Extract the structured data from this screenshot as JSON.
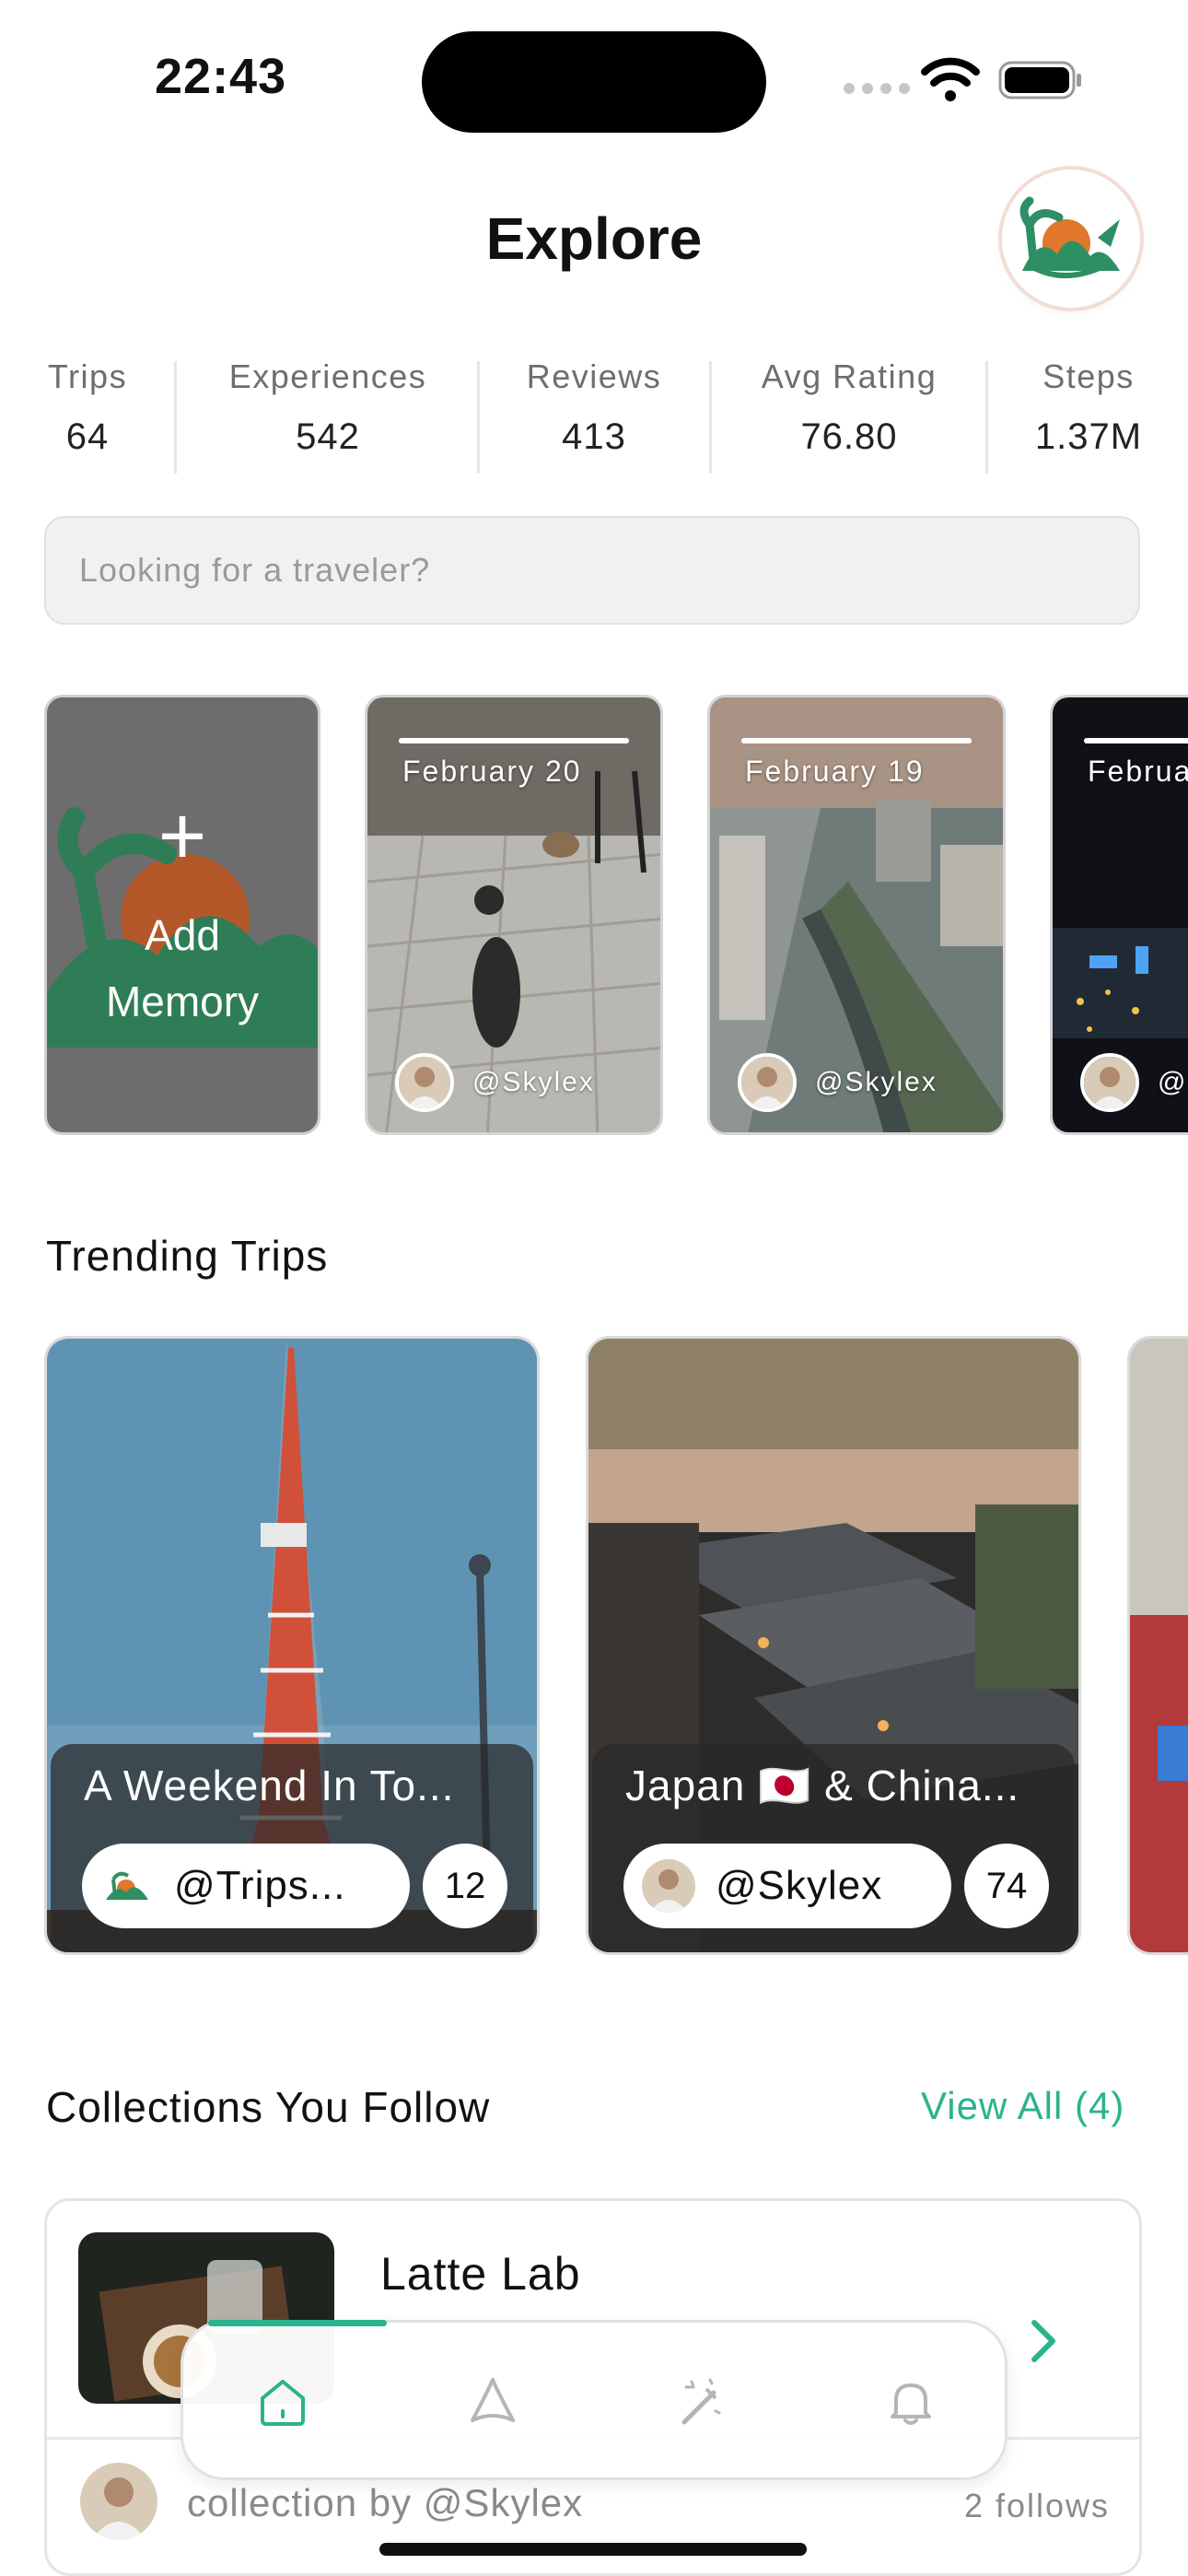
{
  "status_bar": {
    "time": "22:43"
  },
  "header": {
    "title": "Explore",
    "avatar_icon": "palm-sunset-logo-icon"
  },
  "stats": [
    {
      "label": "Trips",
      "value": "64"
    },
    {
      "label": "Experiences",
      "value": "542"
    },
    {
      "label": "Reviews",
      "value": "413"
    },
    {
      "label": "Avg Rating",
      "value": "76.80"
    },
    {
      "label": "Steps",
      "value": "1.37M"
    }
  ],
  "search": {
    "placeholder": "Looking for a traveler?",
    "value": ""
  },
  "stories": {
    "add_label_1": "Add",
    "add_label_2": "Memory",
    "items": [
      {
        "date": "February 20",
        "user": "@Skylex"
      },
      {
        "date": "February 19",
        "user": "@Skylex"
      },
      {
        "date": "February",
        "user": "@Skylex"
      }
    ]
  },
  "trending": {
    "title": "Trending Trips",
    "items": [
      {
        "name": "A Weekend In To...",
        "user": "@Trips...",
        "count": "12"
      },
      {
        "name": "Japan 🇯🇵 & China...",
        "user": "@Skylex",
        "count": "74"
      }
    ]
  },
  "collections": {
    "title": "Collections You Follow",
    "view_all": "View All (4)",
    "items": [
      {
        "name": "Latte Lab",
        "by": "collection by @Skylex",
        "follows": "2 follows"
      }
    ]
  },
  "tabbar": {
    "tabs": [
      {
        "name": "home-icon",
        "active": true
      },
      {
        "name": "explore-icon",
        "active": false
      },
      {
        "name": "magic-wand-icon",
        "active": false
      },
      {
        "name": "bell-icon",
        "active": false
      }
    ]
  },
  "colors": {
    "accent": "#2bb38c",
    "logo_green": "#2e8f64",
    "logo_orange": "#e0772b"
  }
}
